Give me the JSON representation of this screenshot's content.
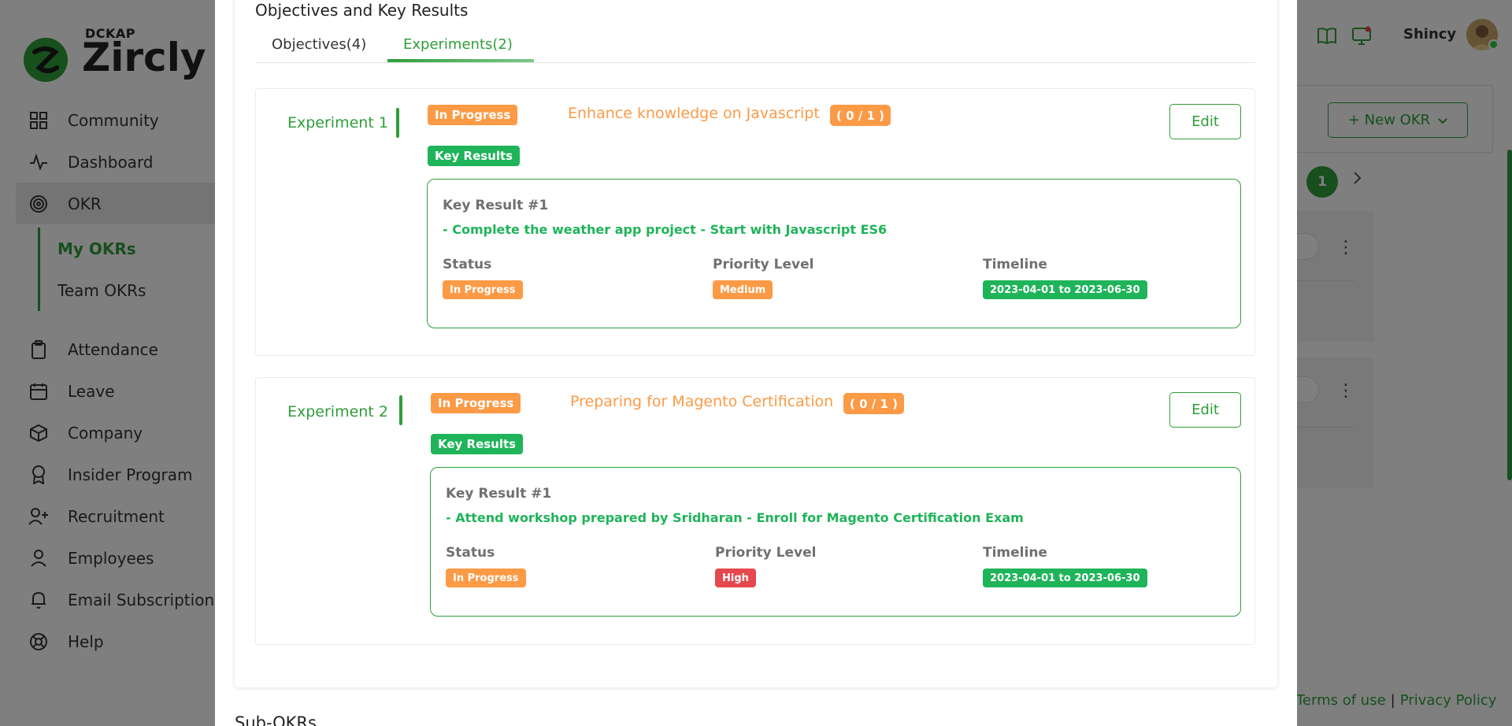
{
  "app": {
    "brand_top": "DCKAP",
    "brand_name": "Zircly",
    "user_name": "Shincy"
  },
  "colors": {
    "accent": "#2f9e3a",
    "orange": "#fc9a46",
    "success": "#1fb45a",
    "danger": "#e5484d"
  },
  "sidebar": {
    "items": [
      {
        "label": "Community",
        "icon": "grid-icon"
      },
      {
        "label": "Dashboard",
        "icon": "activity-icon"
      },
      {
        "label": "OKR",
        "icon": "target-icon"
      },
      {
        "label": "Attendance",
        "icon": "clipboard-icon"
      },
      {
        "label": "Leave",
        "icon": "calendar-icon"
      },
      {
        "label": "Company",
        "icon": "box-icon"
      },
      {
        "label": "Insider Program",
        "icon": "award-icon"
      },
      {
        "label": "Recruitment",
        "icon": "user-plus-icon"
      },
      {
        "label": "Employees",
        "icon": "user-icon"
      },
      {
        "label": "Email Subscription",
        "icon": "bell-icon"
      },
      {
        "label": "Help",
        "icon": "lifebuoy-icon"
      }
    ],
    "okr_sub": [
      {
        "label": "My OKRs"
      },
      {
        "label": "Team OKRs"
      }
    ]
  },
  "background": {
    "new_okr_label": "+ New OKR",
    "page_current": "1",
    "footer_terms": "Terms of use",
    "footer_privacy": "Privacy Policy"
  },
  "modal": {
    "section_title": "Objectives and Key Results",
    "tabs": [
      {
        "label": "Objectives(4)"
      },
      {
        "label": "Experiments(2)"
      }
    ],
    "experiments": [
      {
        "label": "Experiment 1",
        "status": "In Progress",
        "title": "Enhance knowledge on Javascript",
        "count": "( 0 / 1 )",
        "edit_label": "Edit",
        "key_results_label": "Key Results",
        "key_results": [
          {
            "title": "Key Result #1",
            "description": "- Complete the weather app project - Start with Javascript ES6",
            "status_label": "Status",
            "status": "In Progress",
            "priority_label": "Priority Level",
            "priority": "Medium",
            "timeline_label": "Timeline",
            "timeline": "2023-04-01 to 2023-06-30"
          }
        ]
      },
      {
        "label": "Experiment 2",
        "status": "In Progress",
        "title": "Preparing for Magento Certification",
        "count": "( 0 / 1 )",
        "edit_label": "Edit",
        "key_results_label": "Key Results",
        "key_results": [
          {
            "title": "Key Result #1",
            "description": "- Attend workshop prepared by Sridharan - Enroll for Magento Certification Exam",
            "status_label": "Status",
            "status": "In Progress",
            "priority_label": "Priority Level",
            "priority": "High",
            "timeline_label": "Timeline",
            "timeline": "2023-04-01 to 2023-06-30"
          }
        ]
      }
    ],
    "sub_okrs_title": "Sub-OKRs"
  }
}
